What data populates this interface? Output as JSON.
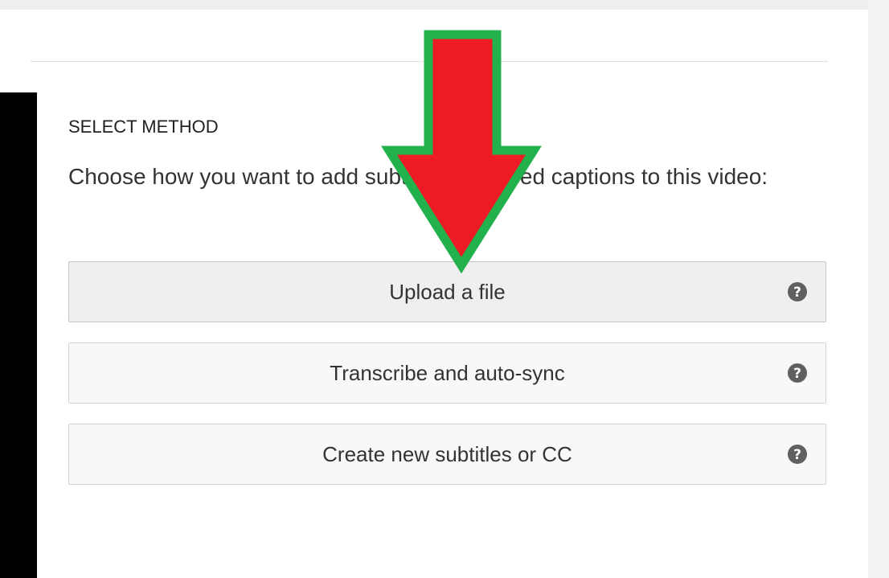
{
  "section": {
    "heading": "SELECT METHOD",
    "description": "Choose how you want to add subtitles or closed captions to this video:"
  },
  "methods": [
    {
      "label": "Upload a file",
      "help_icon": "question-circle-icon",
      "active": true
    },
    {
      "label": "Transcribe and auto-sync",
      "help_icon": "question-circle-icon",
      "active": false
    },
    {
      "label": "Create new subtitles or CC",
      "help_icon": "question-circle-icon",
      "active": false
    }
  ],
  "annotation": {
    "icon": "down-arrow-icon",
    "fill_color": "#ed1c24",
    "stroke_color": "#22b14c"
  },
  "colors": {
    "video_strip": "#000000",
    "button_background": "#f8f8f8",
    "help_icon": "#606060"
  }
}
